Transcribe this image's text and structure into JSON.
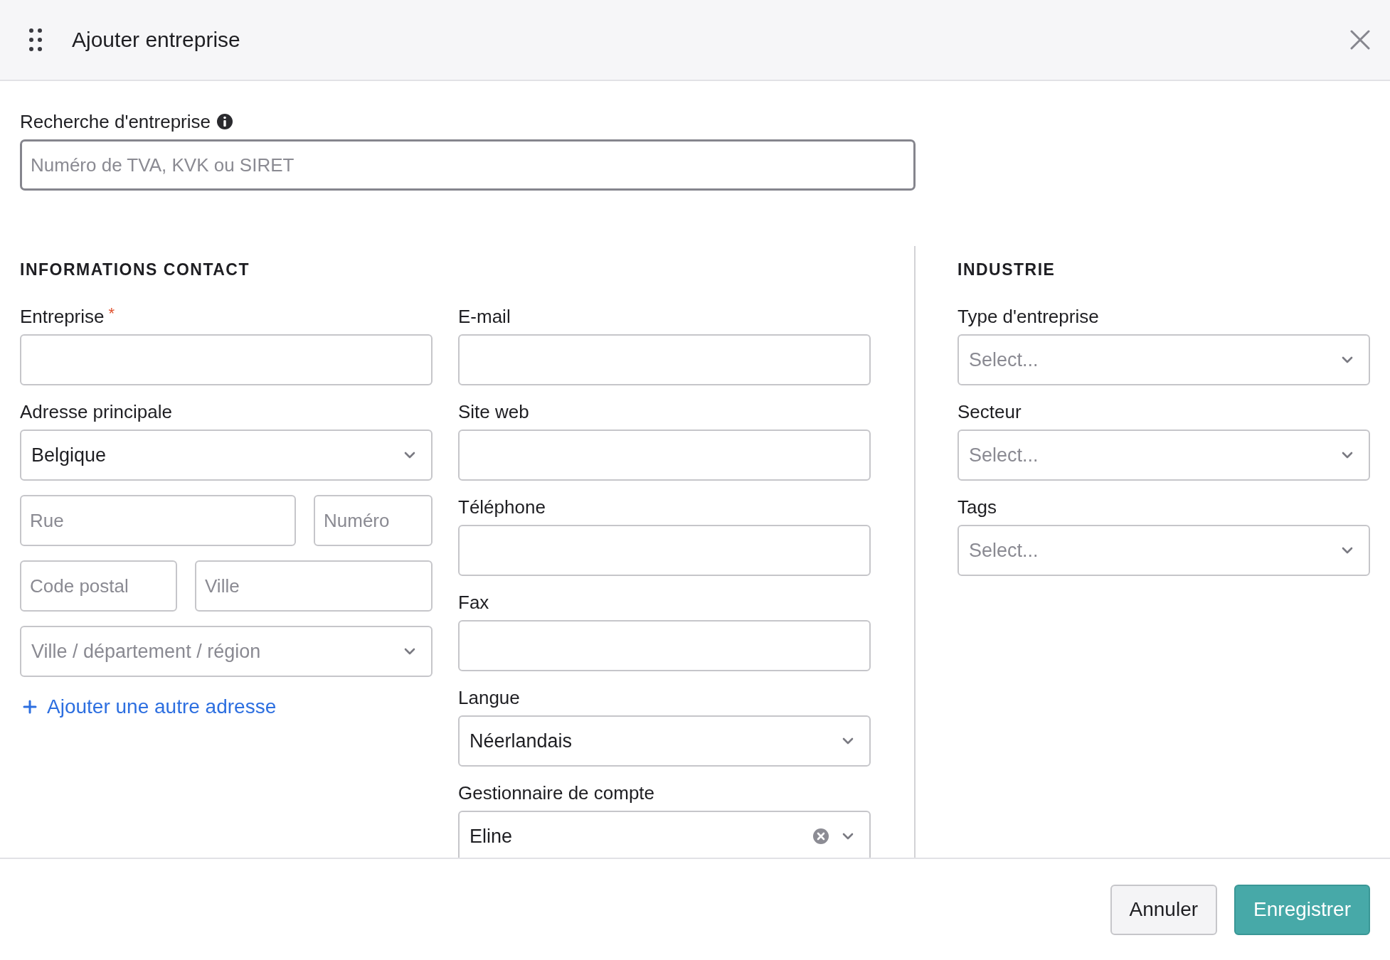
{
  "dialog": {
    "title": "Ajouter entreprise"
  },
  "search": {
    "label": "Recherche d'entreprise",
    "placeholder": "Numéro de TVA, KVK ou SIRET"
  },
  "contact": {
    "heading": "INFORMATIONS CONTACT",
    "left": [
      {
        "kind": "input",
        "label": "Entreprise",
        "required_mark": "*"
      },
      {
        "kind": "select",
        "label": "Adresse principale",
        "value": "Belgique"
      },
      {
        "kind": "row",
        "fields": [
          {
            "placeholder": "Rue"
          },
          {
            "placeholder": "Numéro"
          }
        ]
      },
      {
        "kind": "row",
        "fields": [
          {
            "placeholder": "Code postal"
          },
          {
            "placeholder": "Ville"
          }
        ]
      },
      {
        "kind": "select",
        "placeholder": "Ville / département / région"
      }
    ],
    "add_address": "Ajouter une autre adresse",
    "right": [
      {
        "kind": "input",
        "label": "E-mail"
      },
      {
        "kind": "input",
        "label": "Site web"
      },
      {
        "kind": "input",
        "label": "Téléphone"
      },
      {
        "kind": "input",
        "label": "Fax"
      },
      {
        "kind": "select",
        "label": "Langue",
        "value": "Néerlandais"
      },
      {
        "kind": "select",
        "label": "Gestionnaire de compte",
        "value": "Eline",
        "clearable": true
      }
    ]
  },
  "industry": {
    "heading": "INDUSTRIE",
    "fields": [
      {
        "kind": "select",
        "label": "Type d'entreprise",
        "placeholder": "Select..."
      },
      {
        "kind": "select",
        "label": "Secteur",
        "placeholder": "Select..."
      },
      {
        "kind": "select",
        "label": "Tags",
        "placeholder": "Select..."
      }
    ]
  },
  "buttons": [
    {
      "label": "Annuler",
      "kind": "secondary"
    },
    {
      "label": "Enregistrer",
      "kind": "primary"
    }
  ]
}
